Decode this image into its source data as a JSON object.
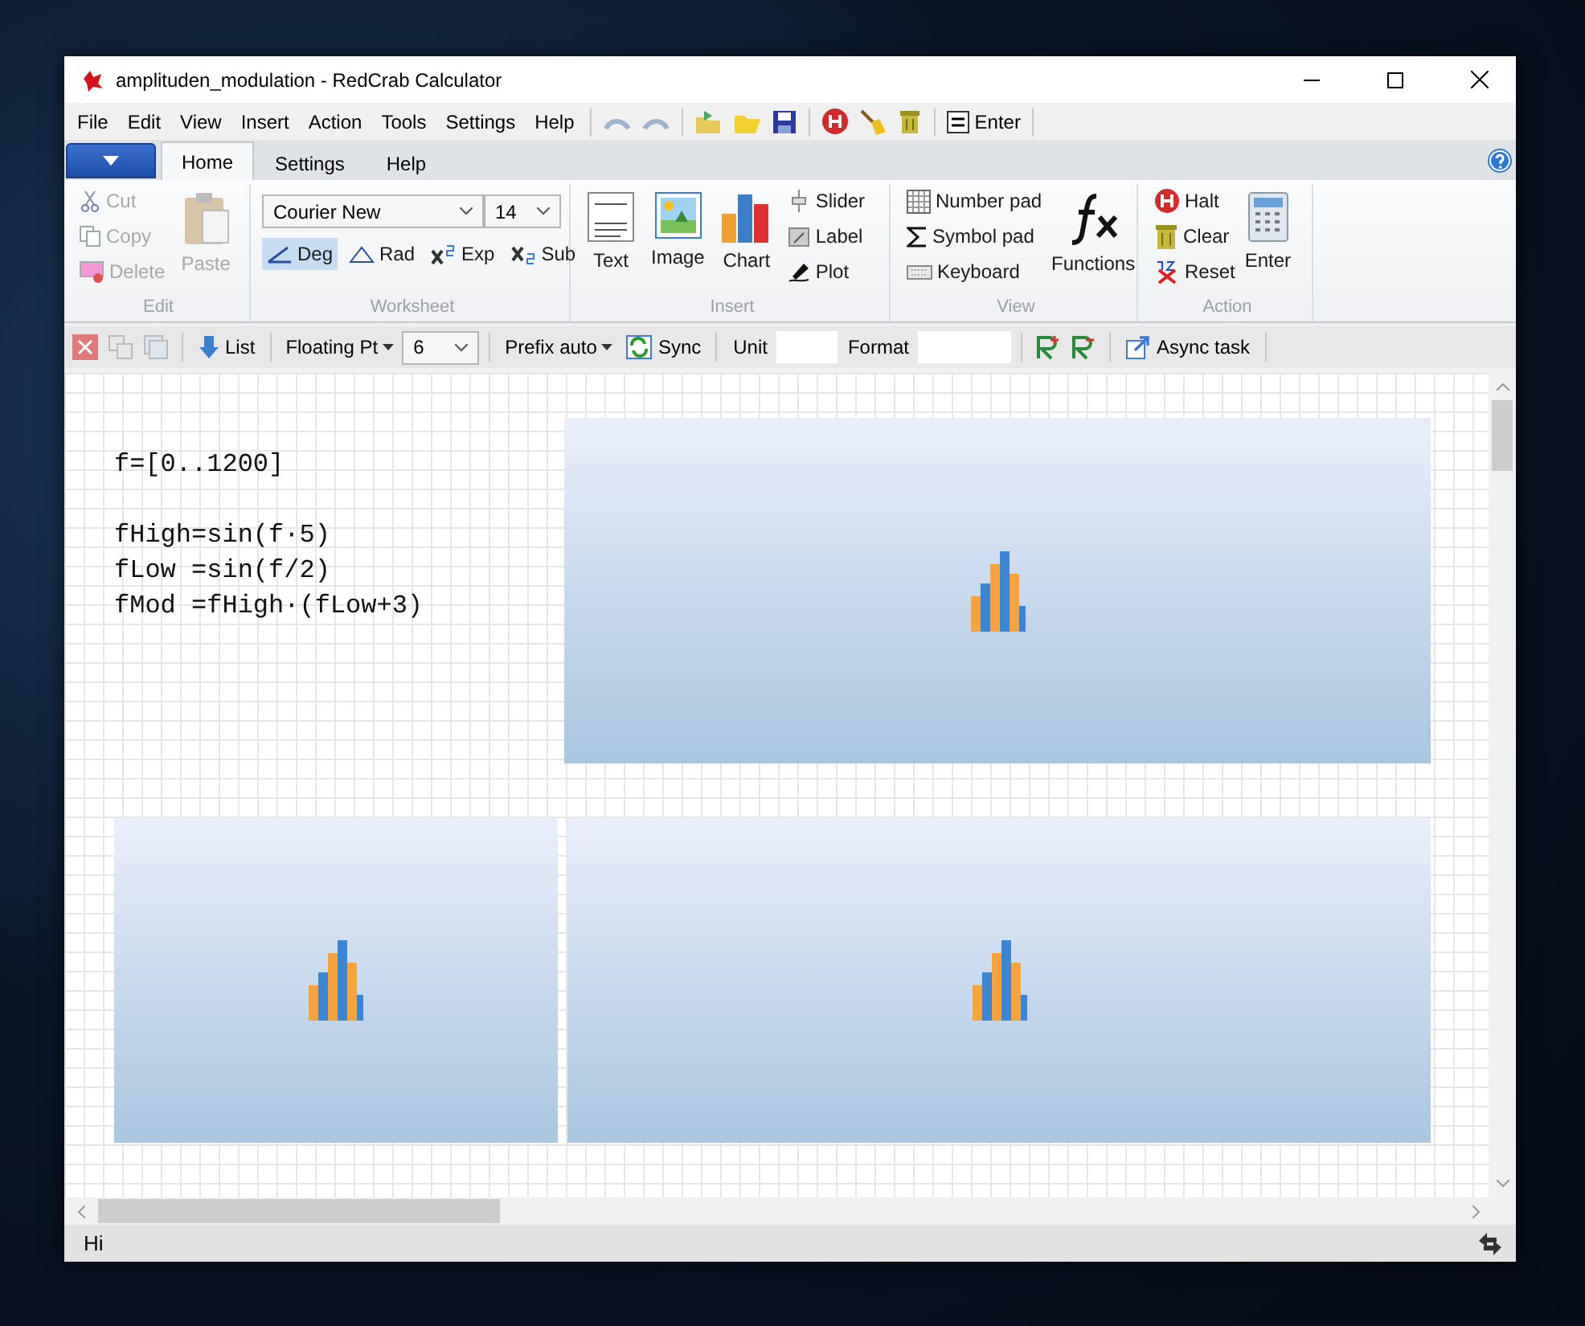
{
  "window": {
    "title": "amplituden_modulation - RedCrab Calculator"
  },
  "menu": [
    "File",
    "Edit",
    "View",
    "Insert",
    "Action",
    "Tools",
    "Settings",
    "Help"
  ],
  "quick_toolbar": {
    "enter": "Enter"
  },
  "tabs": [
    {
      "label": "Home",
      "selected": true
    },
    {
      "label": "Settings",
      "selected": false
    },
    {
      "label": "Help",
      "selected": false
    }
  ],
  "ribbon": {
    "edit": {
      "title": "Edit",
      "cut": {
        "label": "Cut",
        "disabled": true
      },
      "copy": {
        "label": "Copy",
        "disabled": true
      },
      "delete": {
        "label": "Delete",
        "disabled": true
      },
      "paste": {
        "label": "Paste",
        "disabled": true
      }
    },
    "worksheet": {
      "title": "Worksheet",
      "font": "Courier New",
      "size": "14",
      "deg": {
        "label": "Deg",
        "selected": true
      },
      "rad": {
        "label": "Rad",
        "selected": false
      },
      "exp": "Exp",
      "sub": "Sub"
    },
    "insert": {
      "title": "Insert",
      "text": "Text",
      "image": "Image",
      "chart": "Chart",
      "slider": "Slider",
      "label": "Label",
      "plot": "Plot"
    },
    "view": {
      "title": "View",
      "number_pad": "Number pad",
      "symbol_pad": "Symbol pad",
      "keyboard": "Keyboard",
      "functions": "Functions"
    },
    "action": {
      "title": "Action",
      "halt": "Halt",
      "clear": "Clear",
      "reset": "Reset",
      "enter": "Enter"
    }
  },
  "format_bar": {
    "list": "List",
    "number_format": "Floating Pt",
    "digits": "6",
    "prefix": "Prefix auto",
    "sync": "Sync",
    "unit_label": "Unit",
    "format_label": "Format",
    "async": "Async task"
  },
  "worksheet": {
    "blocks": [
      [
        "f=[0..1200]"
      ],
      [
        "fHigh=sin(f·5)",
        "fLow =sin(f/2)",
        "fMod =fHigh·(fLow+3)"
      ]
    ]
  },
  "status_bar": {
    "text": "Hi"
  }
}
